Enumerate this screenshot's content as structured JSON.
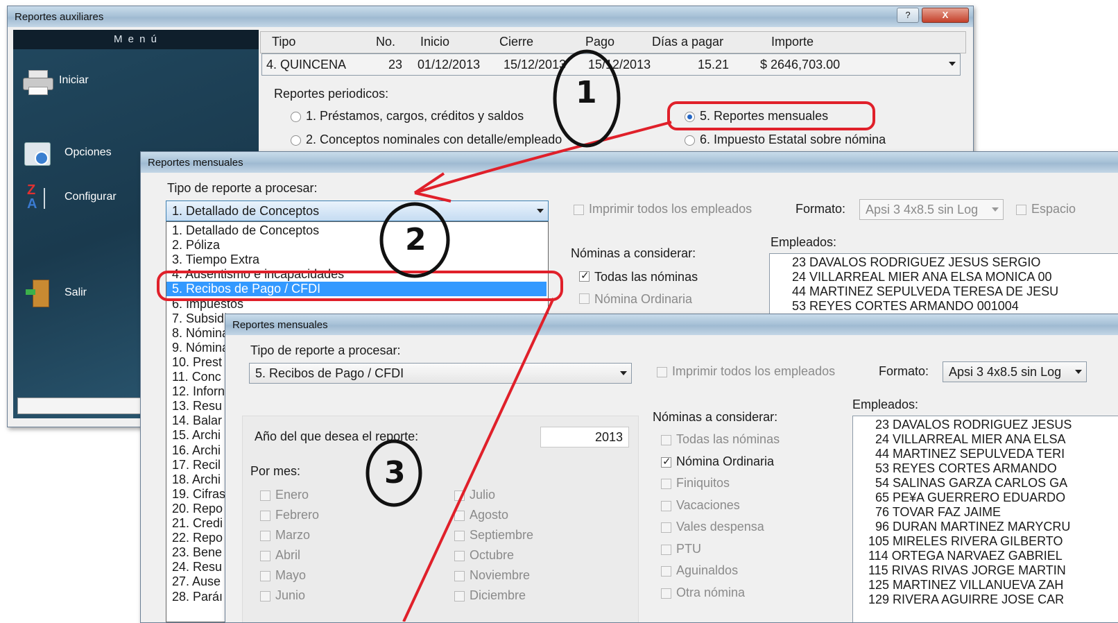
{
  "colors": {
    "annotation_red": "#e0202a",
    "menu_bg": "#1d3d52",
    "selection": "#3399ff"
  },
  "win1": {
    "title": "Reportes auxiliares",
    "help_btn": "?",
    "close_btn": "X",
    "menu_header": "M e n ú",
    "menu_items": [
      {
        "label": "Iniciar",
        "icon": "printer-icon"
      },
      {
        "label": "Opciones",
        "icon": "options-icon"
      },
      {
        "label": "Configurar",
        "icon": "configure-icon"
      },
      {
        "label": "Salir",
        "icon": "exit-door-icon"
      }
    ],
    "payroll_headers": [
      "Tipo",
      "No.",
      "Inicio",
      "Cierre",
      "Pago",
      "Días a pagar",
      "Importe"
    ],
    "payroll_row": [
      "4. QUINCENA",
      "23",
      "01/12/2013",
      "15/12/2013",
      "15/12/2013",
      "15.21",
      "$ 2646,703.00"
    ],
    "periodic_label": "Reportes periodicos:",
    "options": [
      {
        "label": "1. Préstamos, cargos, créditos y saldos",
        "selected": false
      },
      {
        "label": "5. Reportes mensuales",
        "selected": true
      },
      {
        "label": "2. Conceptos nominales con detalle/empleado",
        "selected": false
      },
      {
        "label": "6. Impuesto Estatal sobre nómina",
        "selected": false
      }
    ]
  },
  "win2": {
    "title": "Reportes mensuales",
    "type_label": "Tipo de reporte a procesar:",
    "type_value": "1. Detallado de Conceptos",
    "dropdown_items": [
      "1. Detallado de Conceptos",
      "2. Póliza",
      "3. Tiempo Extra",
      "4. Ausentismo e incapacidades",
      "5. Recibos de Pago / CFDI",
      "6. Impuestos",
      "7. Subsidio",
      "8. Nómina",
      "9. Nómina",
      "10. Prest",
      "11. Conc",
      "12. Inforn",
      "13. Resu",
      "14. Balar",
      "15. Archi",
      "16. Archi",
      "17. Recil",
      "18. Archi",
      "19. Cifras",
      "20. Repo",
      "21. Credi",
      "22. Repo",
      "23. Bene",
      "24. Resu",
      "27. Ause",
      "28. Paráı"
    ],
    "dropdown_selected_index": 4,
    "print_all": "Imprimir todos los empleados",
    "format_label": "Formato:",
    "format_value": "Apsi 3 4x8.5 sin Log",
    "espacio": "Espacio",
    "nominas_label": "Nóminas a considerar:",
    "nominas": [
      {
        "label": "Todas las nóminas",
        "checked": true
      },
      {
        "label": "Nómina Ordinaria",
        "checked": false
      }
    ],
    "empleados_label": "Empleados:",
    "empleados": [
      "23 DAVALOS RODRIGUEZ JESUS SERGIO",
      "24 VILLARREAL MIER ANA ELSA MONICA      00",
      "44 MARTINEZ SEPULVEDA TERESA DE JESU",
      "53 REYES CORTES ARMANDO         001004"
    ]
  },
  "win3": {
    "title": "Reportes mensuales",
    "type_label": "Tipo de reporte a procesar:",
    "type_value": "5. Recibos de Pago / CFDI",
    "print_all": "Imprimir todos los empleados",
    "format_label": "Formato:",
    "format_value": "Apsi 3 4x8.5 sin Log",
    "year_label": "Año del que desea el reporte:",
    "year_value": "2013",
    "por_mes": "Por mes:",
    "months_left": [
      "Enero",
      "Febrero",
      "Marzo",
      "Abril",
      "Mayo",
      "Junio"
    ],
    "months_right": [
      "Julio",
      "Agosto",
      "Septiembre",
      "Octubre",
      "Noviembre",
      "Diciembre"
    ],
    "nominas_label": "Nóminas a considerar:",
    "nominas": [
      {
        "label": "Todas las nóminas",
        "checked": false,
        "enabled": false
      },
      {
        "label": "Nómina Ordinaria",
        "checked": true,
        "enabled": true
      },
      {
        "label": "Finiquitos",
        "checked": false,
        "enabled": false
      },
      {
        "label": "Vacaciones",
        "checked": false,
        "enabled": false
      },
      {
        "label": "Vales despensa",
        "checked": false,
        "enabled": false
      },
      {
        "label": "PTU",
        "checked": false,
        "enabled": false
      },
      {
        "label": "Aguinaldos",
        "checked": false,
        "enabled": false
      },
      {
        "label": "Otra nómina",
        "checked": false,
        "enabled": false
      }
    ],
    "empleados_label": "Empleados:",
    "empleados": [
      "23 DAVALOS RODRIGUEZ JESUS",
      "24 VILLARREAL MIER ANA ELSA",
      "44 MARTINEZ SEPULVEDA TERI",
      "53 REYES CORTES ARMANDO",
      "54 SALINAS GARZA CARLOS GA",
      "65 PE¥A GUERRERO EDUARDO",
      "76 TOVAR FAZ JAIME",
      "96 DURAN MARTINEZ MARYCRU",
      "105 MIRELES RIVERA GILBERTO",
      "114 ORTEGA NARVAEZ GABRIEL",
      "115 RIVAS RIVAS JORGE MARTIN",
      "125 MARTINEZ VILLANUEVA ZAH",
      "129 RIVERA AGUIRRE JOSE CAR"
    ]
  },
  "annotations": [
    {
      "number": "1"
    },
    {
      "number": "2"
    },
    {
      "number": "3"
    }
  ]
}
